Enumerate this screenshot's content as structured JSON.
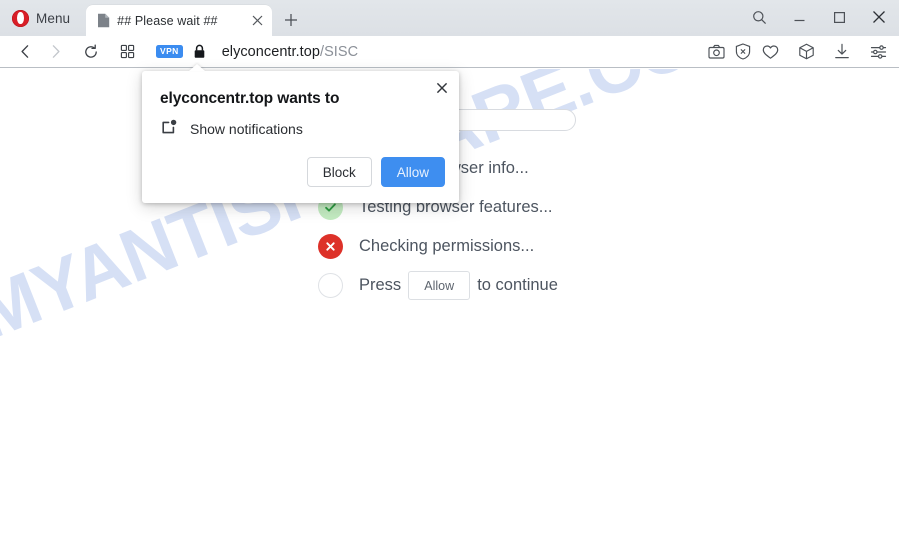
{
  "window": {
    "menu_label": "Menu",
    "controls": {
      "search": "search-icon",
      "minimize": "minimize-icon",
      "maximize": "maximize-icon",
      "close": "close-icon"
    }
  },
  "tabs": [
    {
      "title": "## Please wait ##",
      "favicon": "page-icon",
      "close": "close-icon"
    }
  ],
  "newtab_label": "+",
  "navigation": {
    "back": "back-arrow-icon",
    "forward": "forward-arrow-icon",
    "reload": "reload-icon",
    "grid": "tab-grid-icon"
  },
  "address": {
    "vpn_badge": "VPN",
    "lock": "padlock-icon",
    "host": "elyconcentr.top",
    "path": "/SISC"
  },
  "toolbar_icons": [
    {
      "name": "snapshot-icon",
      "label": "Snapshot"
    },
    {
      "name": "ad-blocker-icon",
      "label": "Ad blocker"
    },
    {
      "name": "heart-icon",
      "label": "Heart"
    },
    {
      "name": "workspaces-cube-icon",
      "label": "Workspaces"
    },
    {
      "name": "downloads-icon",
      "label": "Downloads"
    },
    {
      "name": "easy-setup-icon",
      "label": "Easy setup"
    }
  ],
  "page": {
    "watermark": "MYANTISPYWARE.COM",
    "progress": {
      "percent": 52,
      "color": "#f20d1a"
    },
    "steps": [
      {
        "status": "hidden",
        "label": "Reading browser info..."
      },
      {
        "status": "ok",
        "label": "Testing browser features..."
      },
      {
        "status": "fail",
        "label": "Checking permissions..."
      }
    ],
    "final_step": {
      "status": "idle",
      "prefix": "Press",
      "button": "Allow",
      "suffix": "to continue"
    }
  },
  "permission_dialog": {
    "title": "elyconcentr.top wants to",
    "icon": "notification-badge-icon",
    "permission": "Show notifications",
    "block_label": "Block",
    "allow_label": "Allow",
    "close": "close-icon",
    "allow_color": "#3e8ef0"
  }
}
